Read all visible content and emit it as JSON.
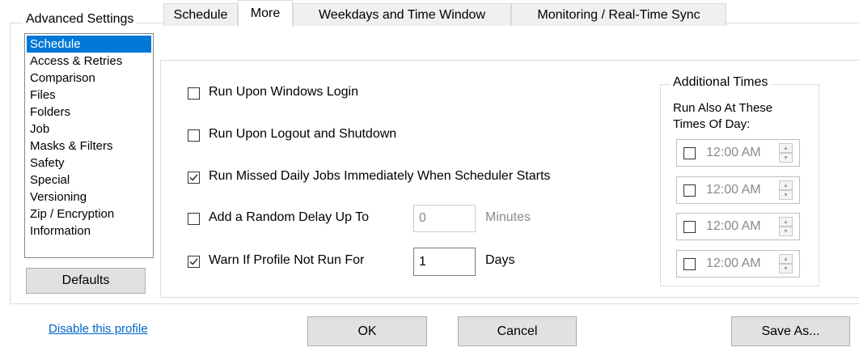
{
  "group_title": "Advanced Settings",
  "categories": [
    {
      "label": "Schedule",
      "selected": true
    },
    {
      "label": "Access & Retries",
      "selected": false
    },
    {
      "label": "Comparison",
      "selected": false
    },
    {
      "label": "Files",
      "selected": false
    },
    {
      "label": "Folders",
      "selected": false
    },
    {
      "label": "Job",
      "selected": false
    },
    {
      "label": "Masks & Filters",
      "selected": false
    },
    {
      "label": "Safety",
      "selected": false
    },
    {
      "label": "Special",
      "selected": false
    },
    {
      "label": "Versioning",
      "selected": false
    },
    {
      "label": "Zip / Encryption",
      "selected": false
    },
    {
      "label": "Information",
      "selected": false
    }
  ],
  "defaults_label": "Defaults",
  "tabs": [
    {
      "label": "Schedule",
      "active": false
    },
    {
      "label": "More",
      "active": true
    },
    {
      "label": "Weekdays and Time Window",
      "active": false
    },
    {
      "label": "Monitoring / Real-Time Sync",
      "active": false
    }
  ],
  "options": {
    "run_login": {
      "label": "Run Upon Windows Login",
      "checked": false
    },
    "run_logout": {
      "label": "Run Upon Logout and Shutdown",
      "checked": false
    },
    "run_missed": {
      "label": "Run Missed Daily Jobs Immediately When Scheduler Starts",
      "checked": true
    },
    "random_delay": {
      "label": "Add a Random Delay Up To",
      "checked": false,
      "value": "0",
      "unit": "Minutes"
    },
    "warn": {
      "label": "Warn If Profile Not Run For",
      "checked": true,
      "value": "1",
      "unit": "Days"
    }
  },
  "additional_times": {
    "title": "Additional Times",
    "caption_line1": "Run Also At These",
    "caption_line2": "Times Of Day:",
    "times": [
      {
        "value": "12:00 AM",
        "checked": false
      },
      {
        "value": "12:00 AM",
        "checked": false
      },
      {
        "value": "12:00 AM",
        "checked": false
      },
      {
        "value": "12:00 AM",
        "checked": false
      }
    ]
  },
  "footer": {
    "disable_link": "Disable this profile",
    "ok_label": "OK",
    "cancel_label": "Cancel",
    "save_as_label": "Save As..."
  },
  "colors": {
    "selection": "#0078d7",
    "link": "#0066cc"
  }
}
